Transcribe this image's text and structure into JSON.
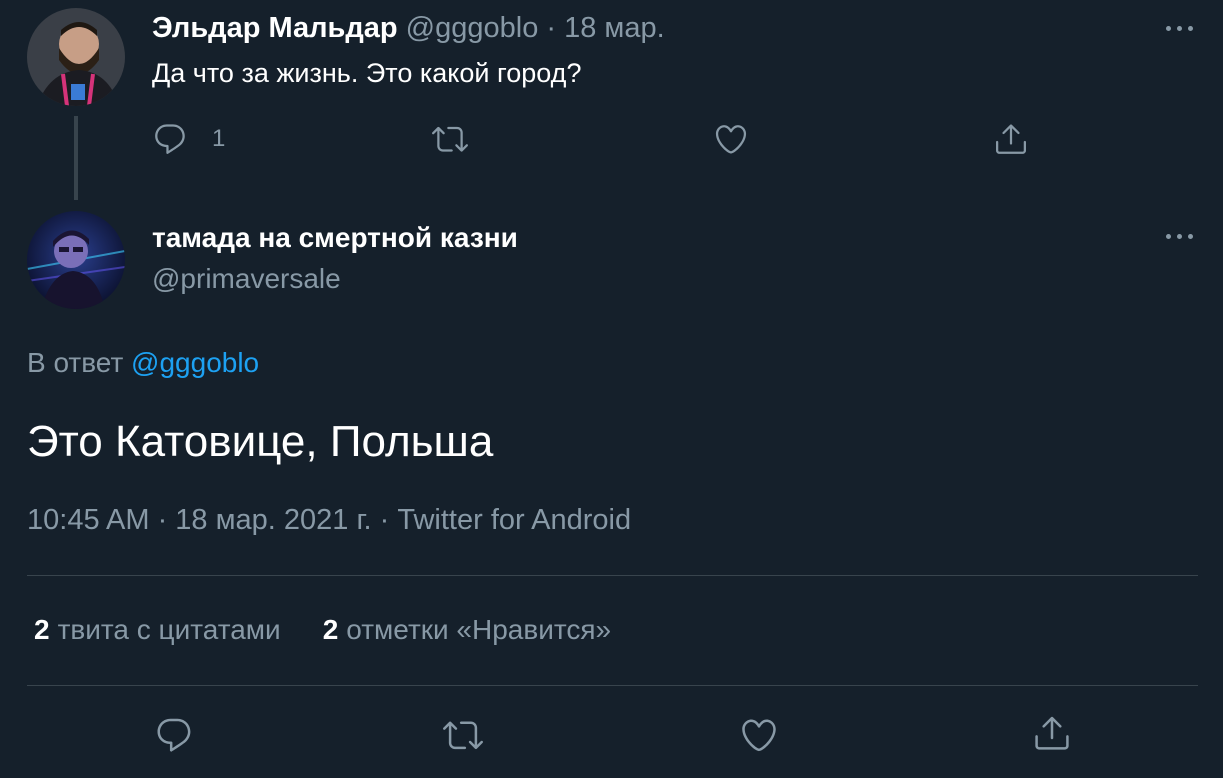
{
  "parent_tweet": {
    "author_name": "Эльдар Мальдар",
    "handle": "@gggoblo",
    "separator": " · ",
    "date": "18 мар.",
    "text": "Да что за жизнь. Это какой город?",
    "reply_count": "1"
  },
  "main_tweet": {
    "author_name": "тамада на смертной казни",
    "handle": "@primaversale",
    "reply_prefix": "В ответ ",
    "reply_handle": "@gggoblo",
    "text": "Это Катовице, Польша",
    "meta": "10:45 AM · 18 мар. 2021 г. · Twitter for Android",
    "stats": [
      {
        "count": "2",
        "label": "твита с цитатами"
      },
      {
        "count": "2",
        "label": "отметки «Нравится»"
      }
    ]
  },
  "icons": {
    "reply": "reply-icon",
    "retweet": "retweet-icon",
    "like": "like-icon",
    "share": "share-icon",
    "more": "more-icon"
  },
  "colors": {
    "background": "#15202b",
    "muted": "#8899a6",
    "link": "#1da1f2",
    "divider": "#38444d"
  }
}
